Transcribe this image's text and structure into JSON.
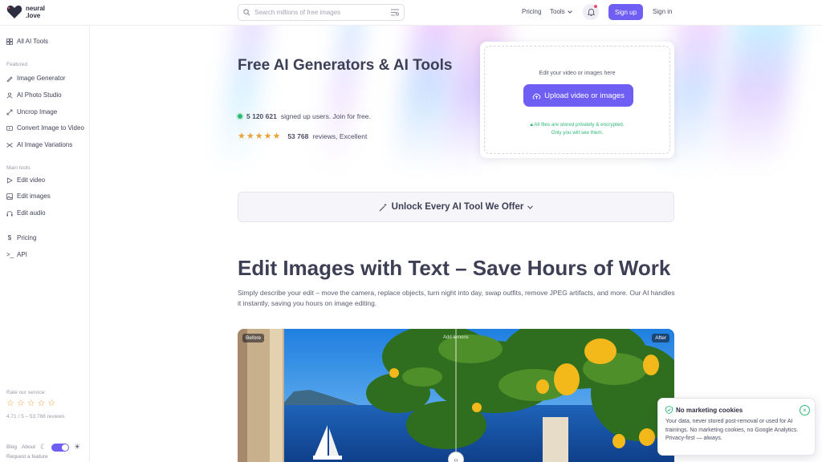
{
  "brand": {
    "name_line1": "neural",
    "name_line2": ".love"
  },
  "header": {
    "search_placeholder": "Search millions of free images",
    "pricing": "Pricing",
    "tools": "Tools",
    "signup": "Sign up",
    "signin": "Sign in"
  },
  "sidebar": {
    "all_tools": "All AI Tools",
    "featured_label": "Featured",
    "featured": [
      "Image Generator",
      "AI Photo Studio",
      "Uncrop Image",
      "Convert Image to Video",
      "AI Image Variations"
    ],
    "main_label": "Main tools",
    "main": [
      "Edit video",
      "Edit images",
      "Edit audio"
    ],
    "pricing": "Pricing",
    "api": "API",
    "rate_label": "Rate our service:",
    "rate_summary": "4.71 / 5 – 53,768 reviews",
    "blog": "Blog",
    "about": "About",
    "request_feature": "Request a feature"
  },
  "hero": {
    "title": "Free AI Generators & AI Tools",
    "users_count": "5 120 621",
    "users_text": "signed up users. Join for free.",
    "reviews_count": "53 768",
    "reviews_text": "reviews, Excellent",
    "rating_stars": 5
  },
  "upload": {
    "hint": "Edit your video or images here",
    "button": "Upload video or images",
    "secure_line1": "All files are stored privately & encrypted.",
    "secure_line2": "Only you will see them."
  },
  "unlock": {
    "label": "Unlock Every AI Tool We Offer"
  },
  "section": {
    "title": "Edit Images with Text – Save Hours of Work",
    "description": "Simply describe your edit – move the camera, replace objects, turn night into day, swap outfits, remove JPEG artifacts, and more. Our AI handles it instantly, saving you hours on image editing."
  },
  "compare": {
    "before": "Before",
    "after": "After",
    "caption": "Add lemons"
  },
  "cookie": {
    "title": "No marketing cookies",
    "body": "Your data, never stored post-removal or used for AI trainings. No marketing cookies, no Google Analytics. Privacy-first — always."
  },
  "colors": {
    "accent": "#6e5ef3",
    "success": "#2fb87a",
    "star": "#e8a23a"
  }
}
